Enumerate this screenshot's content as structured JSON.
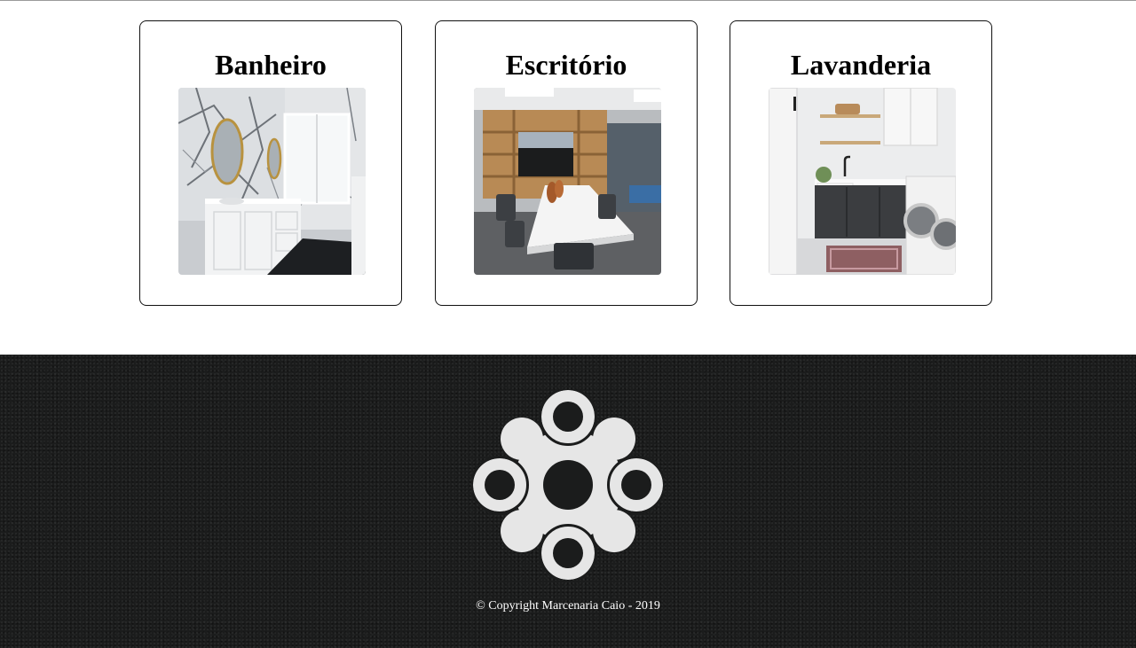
{
  "cards": [
    {
      "title": "Banheiro",
      "image": "bathroom-photo"
    },
    {
      "title": "Escritório",
      "image": "office-photo"
    },
    {
      "title": "Lavanderia",
      "image": "laundry-photo"
    }
  ],
  "footer": {
    "logo": "flower-rings-logo",
    "copyright": "© Copyright Marcenaria Caio - 2019",
    "background_color": "#1b1c1c",
    "logo_color": "#e6e6e6"
  }
}
